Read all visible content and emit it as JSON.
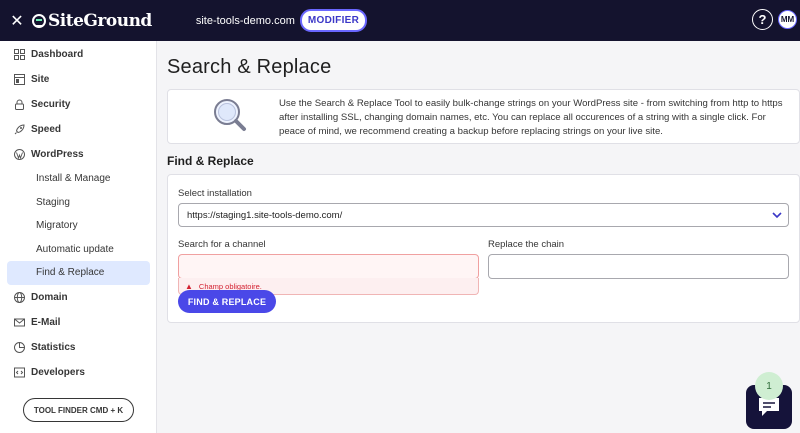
{
  "header": {
    "close_icon": "close-icon",
    "logo_text": "SiteGround",
    "domain": "site-tools-demo.com",
    "badge": "MODIFIER",
    "help_icon": "?",
    "avatar_initials": "MM",
    "colors": {
      "background": "#14132e",
      "accent": "#6a67ff"
    }
  },
  "sidebar": {
    "items": [
      {
        "label": "Dashboard",
        "icon": "grid-icon"
      },
      {
        "label": "Site",
        "icon": "site-icon"
      },
      {
        "label": "Security",
        "icon": "lock-icon"
      },
      {
        "label": "Speed",
        "icon": "rocket-icon"
      },
      {
        "label": "WordPress",
        "icon": "wordpress-icon"
      }
    ],
    "wordpress_sub": [
      {
        "label": "Install & Manage"
      },
      {
        "label": "Staging"
      },
      {
        "label": "Migratory"
      },
      {
        "label": "Automatic update"
      },
      {
        "label": "Find & Replace",
        "active": true
      }
    ],
    "items_after": [
      {
        "label": "Domain",
        "icon": "globe-icon"
      },
      {
        "label": "E-Mail",
        "icon": "mail-icon"
      },
      {
        "label": "Statistics",
        "icon": "chart-icon"
      },
      {
        "label": "Developers",
        "icon": "code-icon"
      }
    ],
    "tool_finder": "TOOL FINDER CMD + K"
  },
  "main": {
    "title": "Search & Replace",
    "info": "Use the Search & Replace Tool to easily bulk-change strings on your WordPress site - from switching from http to https after installing SSL, changing domain names, etc. You can replace all occurences of a string with a single click. For peace of mind, we recommend creating a backup before replacing strings on your live site.",
    "section_title": "Find & Replace",
    "form": {
      "select_label": "Select installation",
      "select_value": "https://staging1.site-tools-demo.com/",
      "search_label": "Search for a channel",
      "search_value": "",
      "search_error": "Champ obligatoire.",
      "replace_label": "Replace the chain",
      "replace_value": "",
      "button": "FIND & REPLACE"
    }
  },
  "chat": {
    "count": "1",
    "icon": "chat-icon"
  }
}
